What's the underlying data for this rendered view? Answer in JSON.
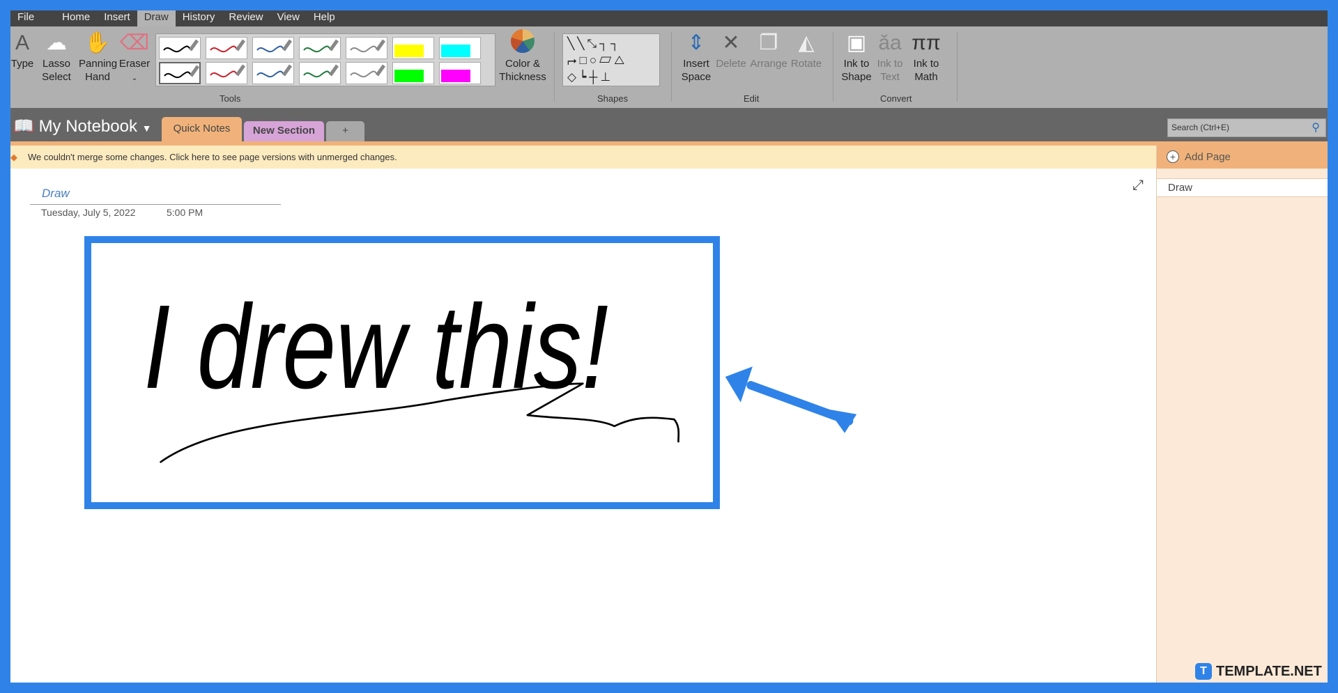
{
  "menu": [
    "File",
    "Home",
    "Insert",
    "Draw",
    "History",
    "Review",
    "View",
    "Help"
  ],
  "active_menu": "Draw",
  "ribbon": {
    "type": "Type",
    "lasso": [
      "Lasso",
      "Select"
    ],
    "panning": [
      "Panning",
      "Hand"
    ],
    "eraser": "Eraser",
    "color_thickness": [
      "Color &",
      "Thickness"
    ],
    "insert_space": [
      "Insert",
      "Space"
    ],
    "delete": "Delete",
    "arrange": "Arrange",
    "rotate": "Rotate",
    "ink_shape": [
      "Ink to",
      "Shape"
    ],
    "ink_text": [
      "Ink to",
      "Text"
    ],
    "ink_math": [
      "Ink to",
      "Math"
    ],
    "groups": {
      "tools": "Tools",
      "shapes": "Shapes",
      "edit": "Edit",
      "convert": "Convert"
    },
    "pen_colors": [
      "#000000",
      "#c8202a",
      "#2f5fa0",
      "#1e7a3a",
      "#888888"
    ],
    "highlighters_top": [
      "#ffff00",
      "#00ffff"
    ],
    "highlighters_bottom": [
      "#00ff00",
      "#ff00ff"
    ]
  },
  "notebook": {
    "name": "My Notebook",
    "sections": [
      "Quick Notes",
      "New Section",
      "+"
    ]
  },
  "search": {
    "placeholder": "Search (Ctrl+E)"
  },
  "warning": "We couldn't merge some changes. Click here to see page versions with unmerged changes.",
  "pane": {
    "add_page": "Add Page",
    "pages": [
      "Draw"
    ]
  },
  "page": {
    "title": "Draw",
    "date": "Tuesday, July 5, 2022",
    "time": "5:00 PM"
  },
  "handwriting": "I drew this!",
  "watermark": "TEMPLATE.NET",
  "accent": "#2f83e8"
}
